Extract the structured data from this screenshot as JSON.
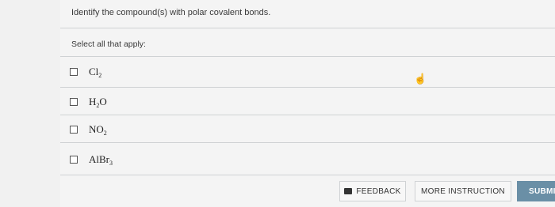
{
  "question": {
    "prompt": "Identify the compound(s) with polar covalent bonds.",
    "instruction": "Select all that apply:"
  },
  "options": [
    {
      "symbol": "Cl",
      "subscript": "2",
      "suffix": ""
    },
    {
      "symbol": "H",
      "subscript": "2",
      "suffix": "O"
    },
    {
      "symbol": "NO",
      "subscript": "2",
      "suffix": ""
    },
    {
      "symbol": "AlBr",
      "subscript": "3",
      "suffix": ""
    }
  ],
  "buttons": {
    "feedback": "FEEDBACK",
    "more_instruction": "MORE INSTRUCTION",
    "submit": "SUBMIT"
  },
  "icons": {
    "feedback": "feedback-icon",
    "cursor": "hand-cursor-icon"
  }
}
